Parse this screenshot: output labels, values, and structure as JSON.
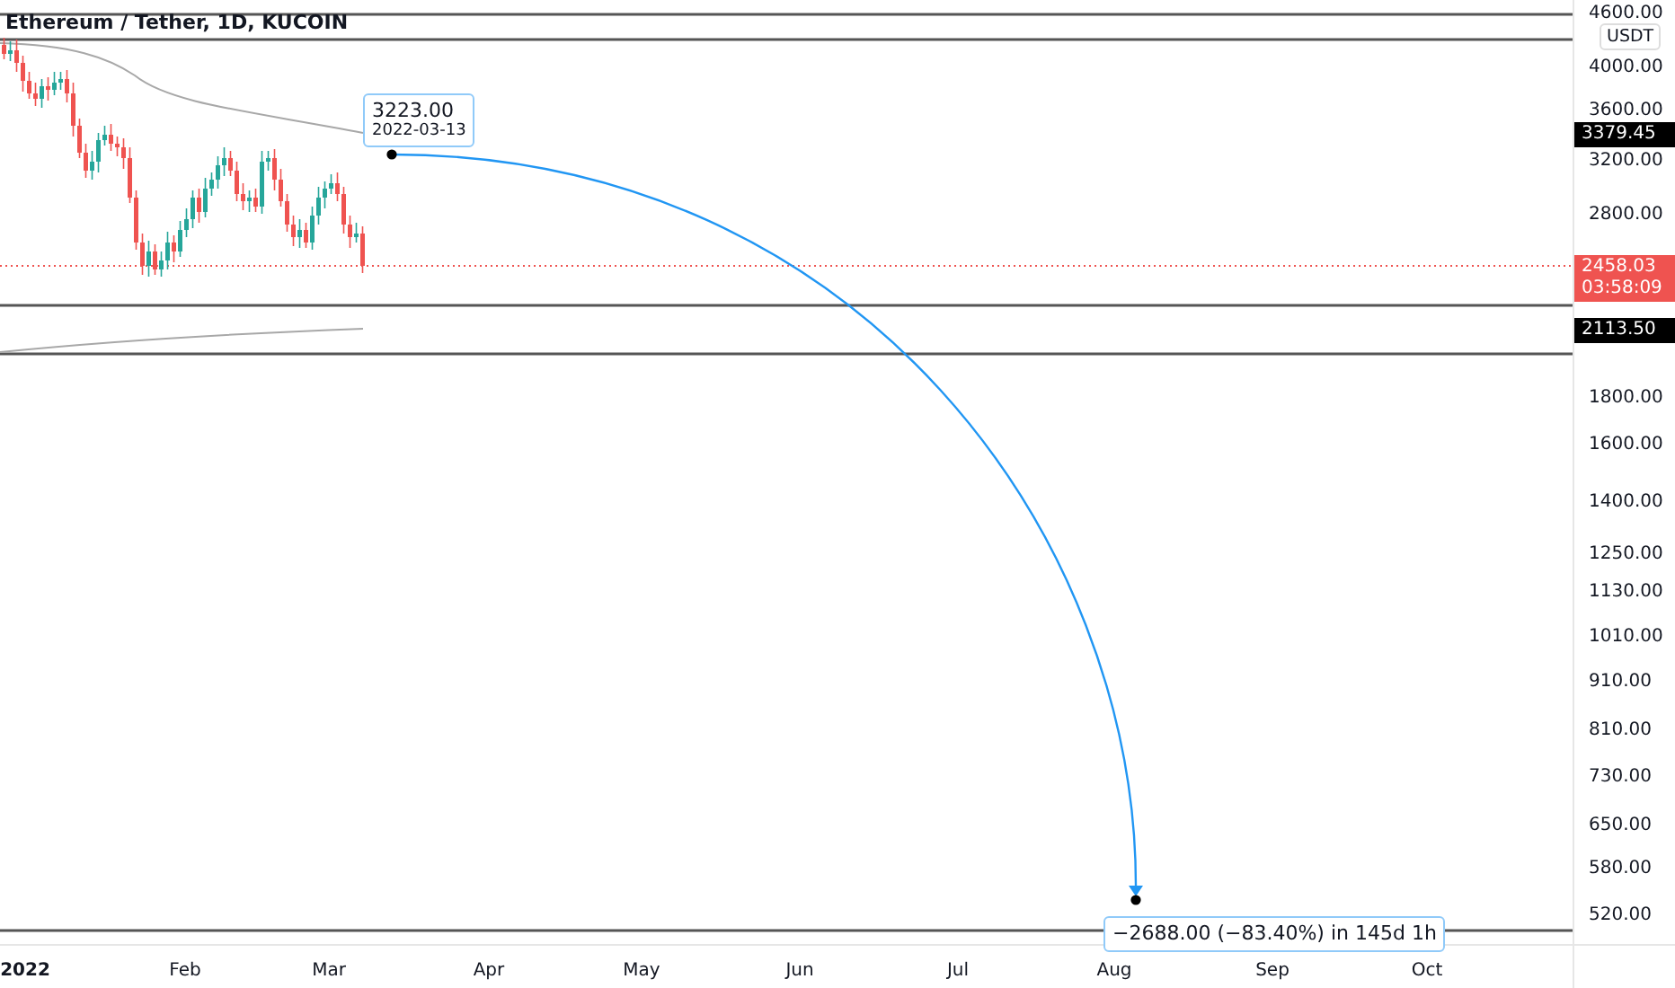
{
  "chart": {
    "title": "Ethereum / Tether, 1D, KUCOIN",
    "currency": "USDT",
    "price_axis": [
      "4600.00",
      "4000.00",
      "3600.00",
      "3200.00",
      "2800.00",
      "1800.00",
      "1600.00",
      "1400.00",
      "1250.00",
      "1130.00",
      "1010.00",
      "910.00",
      "810.00",
      "730.00",
      "650.00",
      "580.00",
      "520.00"
    ],
    "price_badges": [
      {
        "kind": "level",
        "text": "3379.45"
      },
      {
        "kind": "current",
        "text": "2458.03",
        "subtext": "03:58:09"
      },
      {
        "kind": "level",
        "text": "2113.50"
      }
    ],
    "time_axis": [
      {
        "kind": "year",
        "label": "2022"
      },
      {
        "kind": "month",
        "label": "Feb"
      },
      {
        "kind": "month",
        "label": "Mar"
      },
      {
        "kind": "month",
        "label": "Apr"
      },
      {
        "kind": "month",
        "label": "May"
      },
      {
        "kind": "month",
        "label": "Jun"
      },
      {
        "kind": "month",
        "label": "Jul"
      },
      {
        "kind": "month",
        "label": "Aug"
      },
      {
        "kind": "month",
        "label": "Sep"
      },
      {
        "kind": "month",
        "label": "Oct"
      }
    ],
    "start_callout": {
      "price": "3223.00",
      "date": "2022-03-13"
    },
    "end_callout": {
      "text": "−2688.00 (−83.40%) in 145d 1h"
    }
  }
}
